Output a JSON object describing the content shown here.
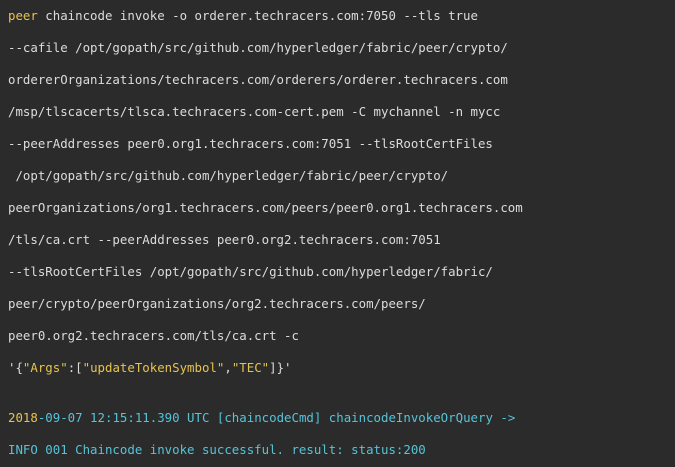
{
  "command": {
    "prompt_word": "peer",
    "lines": [
      " chaincode invoke -o orderer.techracers.com:7050 --tls true",
      "--cafile /opt/gopath/src/github.com/hyperledger/fabric/peer/crypto/",
      "ordererOrganizations/techracers.com/orderers/orderer.techracers.com",
      "/msp/tlscacerts/tlsca.techracers.com-cert.pem -C mychannel -n mycc",
      "--peerAddresses peer0.org1.techracers.com:7051 --tlsRootCertFiles",
      " /opt/gopath/src/github.com/hyperledger/fabric/peer/crypto/",
      "peerOrganizations/org1.techracers.com/peers/peer0.org1.techracers.com",
      "/tls/ca.crt --peerAddresses peer0.org2.techracers.com:7051",
      "--tlsRootCertFiles /opt/gopath/src/github.com/hyperledger/fabric/",
      "peer/crypto/peerOrganizations/org2.techracers.com/peers/",
      "peer0.org2.techracers.com/tls/ca.crt -c"
    ],
    "args": {
      "open": "'{",
      "key": "\"Args\"",
      "colon_bracket": ":[",
      "arg1": "\"updateTokenSymbol\"",
      "comma": ",",
      "arg2": "\"TEC\"",
      "close": "]}'"
    }
  },
  "output": {
    "log_year": "2018",
    "log_rest": "-09-07 12:15:11.390 UTC",
    "log_module": "[chaincodeCmd] chaincodeInvokeOrQuery ->",
    "info_line": "INFO 001 Chaincode invoke successful. result: status:200"
  },
  "colors": {
    "background": "#2b2b2b",
    "text": "#dcdcdc",
    "keyword": "#e6c34e",
    "cyan": "#56c3d8"
  }
}
